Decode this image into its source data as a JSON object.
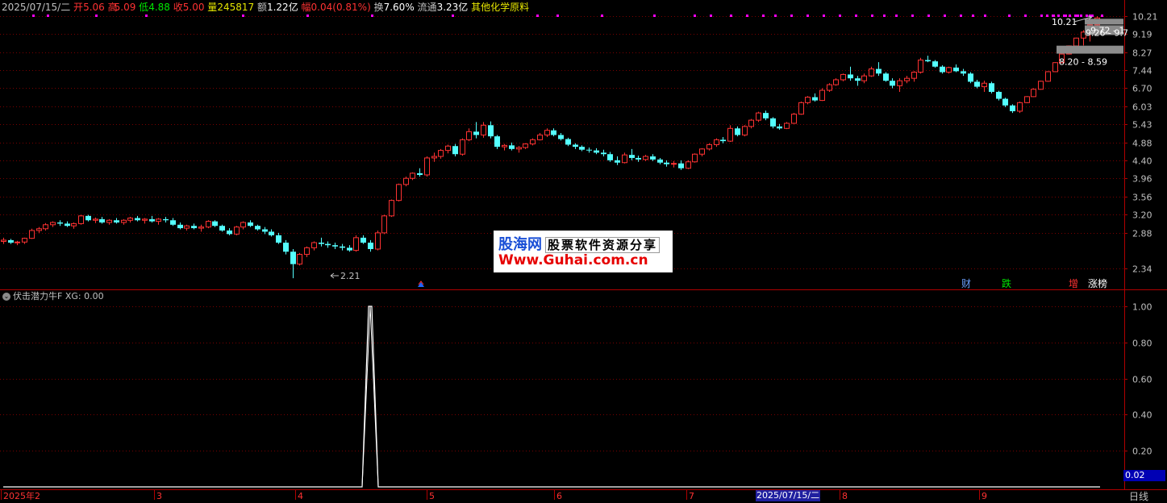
{
  "header": {
    "date": "2025/07/15/二",
    "open_label": "开",
    "open": "5.06",
    "high_label": "高",
    "high": "5.09",
    "low_label": "低",
    "low": "4.88",
    "close_label": "收",
    "close": "5.00",
    "volume_label": "量",
    "volume": "245817",
    "amount_label": "额",
    "amount": "1.22亿",
    "change_label": "幅",
    "change": "0.04(0.81%)",
    "turnover_label": "换",
    "turnover": "7.60%",
    "float_label": "流通",
    "float": "3.23亿",
    "sector": "其他化学原料"
  },
  "price_axis": {
    "ticks": [
      "10.21",
      "9.19",
      "8.27",
      "7.44",
      "6.70",
      "6.03",
      "5.43",
      "4.88",
      "4.40",
      "3.96",
      "3.56",
      "3.20",
      "2.88",
      "2.34"
    ]
  },
  "indicator": {
    "name": "伏击潜力牛F",
    "var_label": "XG:",
    "var_value": "0.00",
    "axis_ticks": [
      "1.00",
      "0.80",
      "0.60",
      "0.40",
      "0.20"
    ],
    "current_value": "0.02"
  },
  "annotations": {
    "low_marker": "2.21",
    "high_marker": "10.21",
    "band1": "9.72 - 1",
    "band2": "9.26 - 9.7",
    "band3": "8.20 - 8.59"
  },
  "event_tags": [
    {
      "text": "财",
      "color": "#6aa0ff"
    },
    {
      "text": "跌",
      "color": "#00e600"
    },
    {
      "text": "增",
      "color": "#ff3232"
    },
    {
      "text": "涨榜",
      "color": "#ffffff"
    }
  ],
  "time_axis": {
    "labels": [
      "2025年2",
      "3",
      "4",
      "5",
      "6",
      "7",
      "8",
      "9"
    ],
    "current_date": "2025/07/15/二",
    "period": "日线"
  },
  "watermark": {
    "brand": "股海网",
    "slogan": "股票软件资源分享",
    "url": "Www.Guhai.com.cn"
  },
  "colors": {
    "up": "#ff3232",
    "down": "#54ffff",
    "grid": "#7a0000",
    "frame": "#b00000",
    "signal_dots": "#ff00ff"
  },
  "chart_data": {
    "type": "candlestick",
    "scale": "log",
    "ylim": [
      2.1,
      10.6
    ],
    "candles_ohlc": [
      [
        2.74,
        2.8,
        2.7,
        2.76
      ],
      [
        2.76,
        2.78,
        2.7,
        2.72
      ],
      [
        2.72,
        2.75,
        2.68,
        2.73
      ],
      [
        2.73,
        2.8,
        2.7,
        2.79
      ],
      [
        2.79,
        2.95,
        2.78,
        2.92
      ],
      [
        2.92,
        2.98,
        2.88,
        2.95
      ],
      [
        2.95,
        3.05,
        2.92,
        3.02
      ],
      [
        3.02,
        3.08,
        2.98,
        3.06
      ],
      [
        3.06,
        3.1,
        3.0,
        3.04
      ],
      [
        3.04,
        3.08,
        2.98,
        3.0
      ],
      [
        3.0,
        3.06,
        2.95,
        3.04
      ],
      [
        3.04,
        3.2,
        3.02,
        3.18
      ],
      [
        3.18,
        3.2,
        3.08,
        3.1
      ],
      [
        3.1,
        3.15,
        3.05,
        3.12
      ],
      [
        3.12,
        3.16,
        3.04,
        3.06
      ],
      [
        3.06,
        3.12,
        3.02,
        3.1
      ],
      [
        3.1,
        3.14,
        3.04,
        3.06
      ],
      [
        3.06,
        3.12,
        3.02,
        3.1
      ],
      [
        3.1,
        3.16,
        3.06,
        3.14
      ],
      [
        3.14,
        3.18,
        3.08,
        3.1
      ],
      [
        3.1,
        3.14,
        3.04,
        3.12
      ],
      [
        3.12,
        3.18,
        3.06,
        3.08
      ],
      [
        3.08,
        3.14,
        3.02,
        3.12
      ],
      [
        3.12,
        3.16,
        3.06,
        3.1
      ],
      [
        3.1,
        3.14,
        3.0,
        3.02
      ],
      [
        3.02,
        3.06,
        2.94,
        2.96
      ],
      [
        2.96,
        3.02,
        2.92,
        3.0
      ],
      [
        3.0,
        3.04,
        2.94,
        2.96
      ],
      [
        2.96,
        3.02,
        2.9,
        2.98
      ],
      [
        2.98,
        3.1,
        2.96,
        3.08
      ],
      [
        3.08,
        3.1,
        2.98,
        3.0
      ],
      [
        3.0,
        3.02,
        2.9,
        2.92
      ],
      [
        2.92,
        2.96,
        2.84,
        2.86
      ],
      [
        2.86,
        3.0,
        2.84,
        2.98
      ],
      [
        2.98,
        3.08,
        2.94,
        3.06
      ],
      [
        3.06,
        3.1,
        2.98,
        3.0
      ],
      [
        3.0,
        3.02,
        2.92,
        2.94
      ],
      [
        2.94,
        2.98,
        2.86,
        2.9
      ],
      [
        2.9,
        2.94,
        2.82,
        2.84
      ],
      [
        2.84,
        2.88,
        2.7,
        2.72
      ],
      [
        2.72,
        2.76,
        2.54,
        2.58
      ],
      [
        2.58,
        2.62,
        2.21,
        2.4
      ],
      [
        2.4,
        2.56,
        2.38,
        2.54
      ],
      [
        2.54,
        2.66,
        2.5,
        2.64
      ],
      [
        2.64,
        2.74,
        2.6,
        2.72
      ],
      [
        2.72,
        2.8,
        2.66,
        2.7
      ],
      [
        2.7,
        2.74,
        2.64,
        2.68
      ],
      [
        2.68,
        2.72,
        2.62,
        2.66
      ],
      [
        2.66,
        2.7,
        2.6,
        2.64
      ],
      [
        2.64,
        2.68,
        2.58,
        2.6
      ],
      [
        2.6,
        2.84,
        2.58,
        2.8
      ],
      [
        2.8,
        2.84,
        2.7,
        2.72
      ],
      [
        2.72,
        2.76,
        2.58,
        2.62
      ],
      [
        2.62,
        2.92,
        2.6,
        2.88
      ],
      [
        2.88,
        3.2,
        2.86,
        3.18
      ],
      [
        3.18,
        3.5,
        3.16,
        3.48
      ],
      [
        3.48,
        3.84,
        3.46,
        3.82
      ],
      [
        3.82,
        4.0,
        3.78,
        3.96
      ],
      [
        3.96,
        4.1,
        3.92,
        4.08
      ],
      [
        4.08,
        4.2,
        4.0,
        4.04
      ],
      [
        4.04,
        4.5,
        4.0,
        4.46
      ],
      [
        4.46,
        4.6,
        4.36,
        4.5
      ],
      [
        4.5,
        4.7,
        4.44,
        4.66
      ],
      [
        4.66,
        4.82,
        4.58,
        4.78
      ],
      [
        4.78,
        4.84,
        4.5,
        4.56
      ],
      [
        4.56,
        5.0,
        4.52,
        4.96
      ],
      [
        4.96,
        5.3,
        4.92,
        5.2
      ],
      [
        5.2,
        5.5,
        5.0,
        5.1
      ],
      [
        5.1,
        5.5,
        5.02,
        5.4
      ],
      [
        5.4,
        5.52,
        5.0,
        5.06
      ],
      [
        5.06,
        5.1,
        4.7,
        4.76
      ],
      [
        4.76,
        4.84,
        4.66,
        4.8
      ],
      [
        4.8,
        4.88,
        4.66,
        4.7
      ],
      [
        4.7,
        4.78,
        4.6,
        4.74
      ],
      [
        4.74,
        4.86,
        4.7,
        4.84
      ],
      [
        4.84,
        5.0,
        4.8,
        4.96
      ],
      [
        4.96,
        5.16,
        4.94,
        5.1
      ],
      [
        5.1,
        5.3,
        5.04,
        5.24
      ],
      [
        5.24,
        5.3,
        5.06,
        5.1
      ],
      [
        5.1,
        5.16,
        4.94,
        4.98
      ],
      [
        4.98,
        5.02,
        4.78,
        4.82
      ],
      [
        4.82,
        4.86,
        4.7,
        4.76
      ],
      [
        4.76,
        4.8,
        4.64,
        4.68
      ],
      [
        4.68,
        4.74,
        4.6,
        4.66
      ],
      [
        4.66,
        4.72,
        4.56,
        4.6
      ],
      [
        4.6,
        4.68,
        4.5,
        4.56
      ],
      [
        4.56,
        4.62,
        4.36,
        4.4
      ],
      [
        4.4,
        4.5,
        4.28,
        4.34
      ],
      [
        4.34,
        4.6,
        4.32,
        4.54
      ],
      [
        4.54,
        4.7,
        4.4,
        4.46
      ],
      [
        4.46,
        4.52,
        4.36,
        4.42
      ],
      [
        4.42,
        4.54,
        4.38,
        4.5
      ],
      [
        4.5,
        4.56,
        4.38,
        4.42
      ],
      [
        4.42,
        4.46,
        4.3,
        4.34
      ],
      [
        4.34,
        4.4,
        4.24,
        4.3
      ],
      [
        4.3,
        4.38,
        4.22,
        4.32
      ],
      [
        4.32,
        4.4,
        4.16,
        4.2
      ],
      [
        4.2,
        4.4,
        4.18,
        4.36
      ],
      [
        4.36,
        4.58,
        4.34,
        4.56
      ],
      [
        4.56,
        4.72,
        4.5,
        4.7
      ],
      [
        4.7,
        4.86,
        4.66,
        4.82
      ],
      [
        4.82,
        5.0,
        4.76,
        4.96
      ],
      [
        4.96,
        5.04,
        4.86,
        4.92
      ],
      [
        4.92,
        5.4,
        4.9,
        5.3
      ],
      [
        5.3,
        5.36,
        5.06,
        5.1
      ],
      [
        5.1,
        5.4,
        5.06,
        5.36
      ],
      [
        5.36,
        5.6,
        5.3,
        5.56
      ],
      [
        5.56,
        5.84,
        5.5,
        5.8
      ],
      [
        5.8,
        5.88,
        5.56,
        5.62
      ],
      [
        5.62,
        5.66,
        5.3,
        5.36
      ],
      [
        5.36,
        5.44,
        5.26,
        5.3
      ],
      [
        5.3,
        5.5,
        5.28,
        5.46
      ],
      [
        5.46,
        5.8,
        5.44,
        5.76
      ],
      [
        5.76,
        6.2,
        5.74,
        6.16
      ],
      [
        6.16,
        6.4,
        6.1,
        6.36
      ],
      [
        6.36,
        6.5,
        6.2,
        6.24
      ],
      [
        6.24,
        6.7,
        6.22,
        6.62
      ],
      [
        6.62,
        6.9,
        6.56,
        6.84
      ],
      [
        6.84,
        7.1,
        6.8,
        7.04
      ],
      [
        7.04,
        7.3,
        6.98,
        7.26
      ],
      [
        7.26,
        7.6,
        7.0,
        7.1
      ],
      [
        7.1,
        7.2,
        6.8,
        7.0
      ],
      [
        7.0,
        7.3,
        6.9,
        7.2
      ],
      [
        7.2,
        7.6,
        7.16,
        7.5
      ],
      [
        7.5,
        7.8,
        7.2,
        7.3
      ],
      [
        7.3,
        7.36,
        6.96,
        7.0
      ],
      [
        7.0,
        7.1,
        6.7,
        6.8
      ],
      [
        6.8,
        7.1,
        6.56,
        7.0
      ],
      [
        7.0,
        7.2,
        6.9,
        7.1
      ],
      [
        7.1,
        7.4,
        6.96,
        7.36
      ],
      [
        7.36,
        8.0,
        7.3,
        7.9
      ],
      [
        7.9,
        8.1,
        7.8,
        7.84
      ],
      [
        7.84,
        7.9,
        7.56,
        7.6
      ],
      [
        7.6,
        7.66,
        7.3,
        7.36
      ],
      [
        7.36,
        7.6,
        7.3,
        7.56
      ],
      [
        7.56,
        7.7,
        7.36,
        7.4
      ],
      [
        7.4,
        7.5,
        7.2,
        7.3
      ],
      [
        7.3,
        7.36,
        6.9,
        6.96
      ],
      [
        6.96,
        7.04,
        6.7,
        6.76
      ],
      [
        6.76,
        7.0,
        6.56,
        6.9
      ],
      [
        6.9,
        6.96,
        6.5,
        6.56
      ],
      [
        6.56,
        6.6,
        6.24,
        6.3
      ],
      [
        6.3,
        6.34,
        6.0,
        6.06
      ],
      [
        6.06,
        6.1,
        5.8,
        5.86
      ],
      [
        5.86,
        6.2,
        5.8,
        6.16
      ],
      [
        6.16,
        6.4,
        6.14,
        6.38
      ],
      [
        6.38,
        6.7,
        6.36,
        6.66
      ],
      [
        6.66,
        7.0,
        6.64,
        6.98
      ],
      [
        6.98,
        7.4,
        6.96,
        7.38
      ],
      [
        7.38,
        7.8,
        7.36,
        7.78
      ],
      [
        7.78,
        8.2,
        7.76,
        8.18
      ],
      [
        8.18,
        8.6,
        8.16,
        8.58
      ],
      [
        8.58,
        9.0,
        8.56,
        8.98
      ],
      [
        8.98,
        9.4,
        8.6,
        9.3
      ],
      [
        9.3,
        10.0,
        8.8,
        9.7
      ],
      [
        9.7,
        10.21,
        9.6,
        10.1
      ]
    ],
    "signal_spike": {
      "x_index": 52,
      "value": 1.0
    },
    "indicator_ylim": [
      0,
      1.0
    ]
  }
}
